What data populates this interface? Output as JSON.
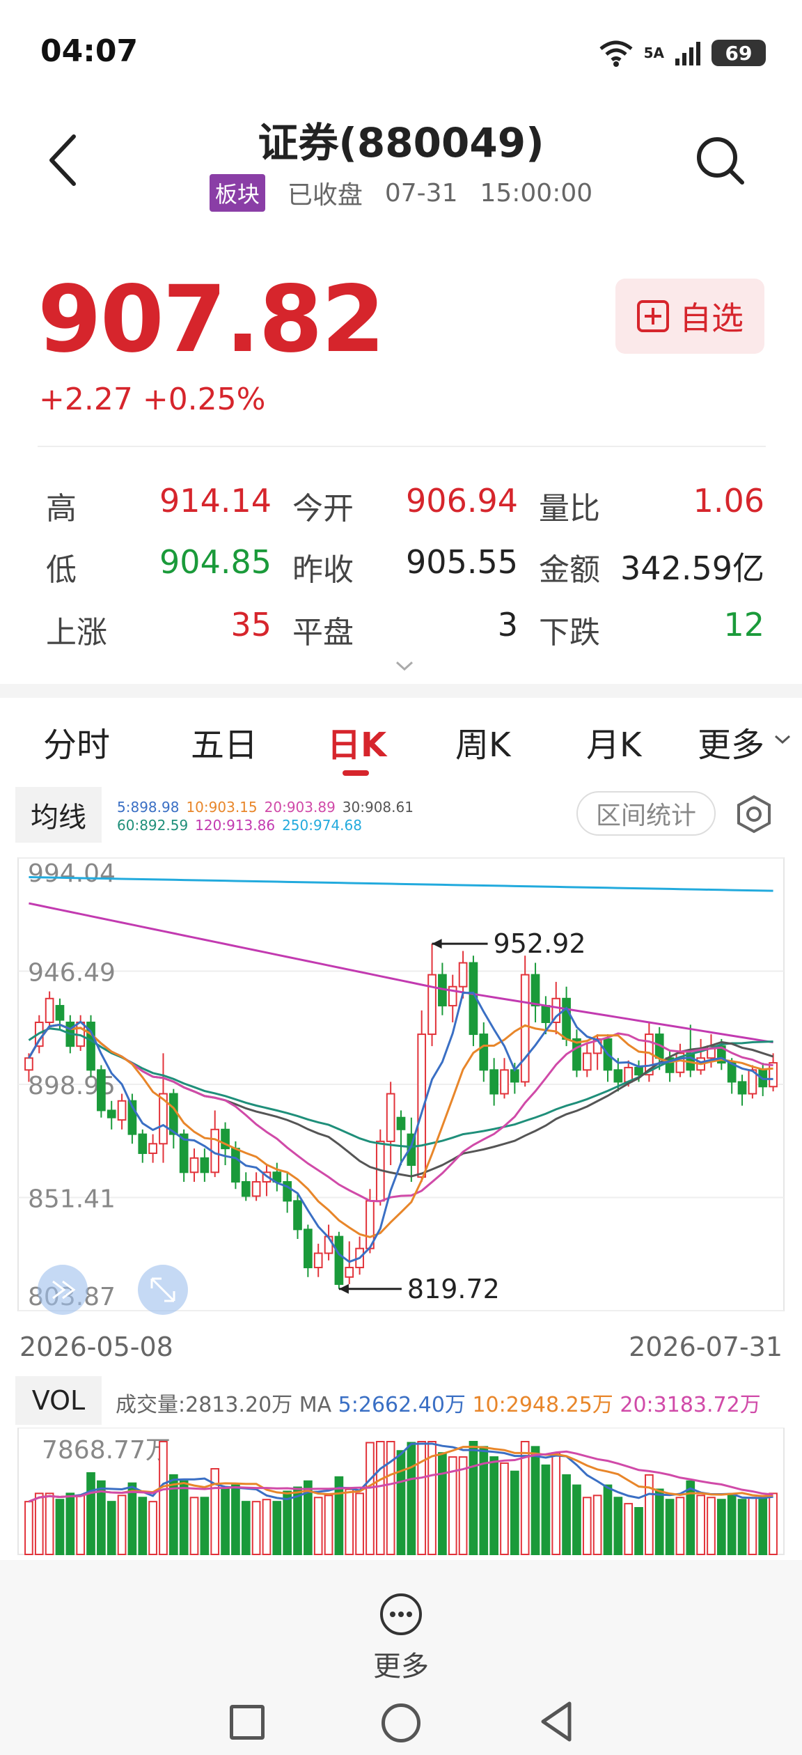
{
  "status": {
    "time": "04:07",
    "network": "5A",
    "battery": "69"
  },
  "header": {
    "title": "证券(880049)",
    "tag": "板块",
    "market_status": "已收盘",
    "date": "07-31",
    "time": "15:00:00"
  },
  "quote": {
    "price": "907.82",
    "change": "+2.27 +0.25%",
    "watch_label": "自选"
  },
  "stats": [
    {
      "label": "高",
      "value": "914.14",
      "color": "red"
    },
    {
      "label": "今开",
      "value": "906.94",
      "color": "red"
    },
    {
      "label": "量比",
      "value": "1.06",
      "color": "red"
    },
    {
      "label": "低",
      "value": "904.85",
      "color": "green"
    },
    {
      "label": "昨收",
      "value": "905.55",
      "color": "black"
    },
    {
      "label": "金额",
      "value": "342.59亿",
      "color": "black"
    },
    {
      "label": "上涨",
      "value": "35",
      "color": "red"
    },
    {
      "label": "平盘",
      "value": "3",
      "color": "black"
    },
    {
      "label": "下跌",
      "value": "12",
      "color": "green"
    }
  ],
  "tabs": [
    "分时",
    "五日",
    "日K",
    "周K",
    "月K",
    "更多"
  ],
  "active_tab": "日K",
  "ma": {
    "label": "均线",
    "line1": [
      "5:898.98",
      "10:903.15",
      "20:903.89",
      "30:908.61"
    ],
    "line2": [
      "60:892.59",
      "120:913.86",
      "250:974.68"
    ],
    "colors": [
      "#3a6fc4",
      "#e8862a",
      "#d04aa8",
      "#555555",
      "#1f8f7a",
      "#c23ab0",
      "#22aadd"
    ],
    "range_button": "区间统计"
  },
  "chart_data": {
    "type": "candlestick",
    "y_ticks": [
      "994.04",
      "946.49",
      "898.95",
      "851.41",
      "803.87"
    ],
    "ylim": [
      803.87,
      994.04
    ],
    "x_start": "2026-05-08",
    "x_end": "2026-07-31",
    "annotations": [
      {
        "label": "952.92",
        "kind": "high"
      },
      {
        "label": "819.72",
        "kind": "low"
      }
    ],
    "candles": [
      [
        905,
        910,
        900,
        912
      ],
      [
        915,
        925,
        912,
        928
      ],
      [
        925,
        935,
        922,
        938
      ],
      [
        932,
        926,
        922,
        935
      ],
      [
        925,
        915,
        912,
        928
      ],
      [
        915,
        925,
        913,
        928
      ],
      [
        925,
        905,
        902,
        928
      ],
      [
        905,
        888,
        885,
        907
      ],
      [
        888,
        885,
        880,
        892
      ],
      [
        884,
        892,
        880,
        895
      ],
      [
        892,
        878,
        874,
        895
      ],
      [
        878,
        870,
        866,
        880
      ],
      [
        870,
        874,
        866,
        878
      ],
      [
        874,
        895,
        866,
        912
      ],
      [
        895,
        878,
        872,
        897
      ],
      [
        878,
        862,
        858,
        880
      ],
      [
        862,
        868,
        858,
        872
      ],
      [
        868,
        862,
        858,
        872
      ],
      [
        862,
        880,
        860,
        888
      ],
      [
        880,
        872,
        865,
        883
      ],
      [
        872,
        858,
        855,
        875
      ],
      [
        858,
        852,
        850,
        862
      ],
      [
        852,
        858,
        850,
        862
      ],
      [
        858,
        862,
        852,
        865
      ],
      [
        862,
        858,
        854,
        866
      ],
      [
        858,
        850,
        845,
        862
      ],
      [
        850,
        838,
        834,
        853
      ],
      [
        838,
        822,
        818,
        840
      ],
      [
        822,
        828,
        818,
        832
      ],
      [
        828,
        835,
        825,
        840
      ],
      [
        835,
        815,
        813,
        837
      ],
      [
        818,
        822,
        815,
        833
      ],
      [
        822,
        830,
        819,
        835
      ],
      [
        830,
        850,
        828,
        855
      ],
      [
        850,
        875,
        848,
        880
      ],
      [
        875,
        895,
        865,
        900
      ],
      [
        885,
        880,
        865,
        888
      ],
      [
        878,
        865,
        858,
        885
      ],
      [
        860,
        920,
        858,
        930
      ],
      [
        920,
        945,
        915,
        958
      ],
      [
        945,
        932,
        928,
        950
      ],
      [
        932,
        940,
        925,
        945
      ],
      [
        940,
        950,
        935,
        955
      ],
      [
        950,
        920,
        915,
        953
      ],
      [
        920,
        905,
        900,
        925
      ],
      [
        905,
        895,
        890,
        910
      ],
      [
        895,
        905,
        893,
        910
      ],
      [
        905,
        900,
        895,
        908
      ],
      [
        900,
        945,
        898,
        953
      ],
      [
        945,
        932,
        925,
        950
      ],
      [
        932,
        925,
        920,
        936
      ],
      [
        925,
        935,
        920,
        942
      ],
      [
        935,
        918,
        915,
        940
      ],
      [
        918,
        905,
        902,
        922
      ],
      [
        905,
        912,
        902,
        916
      ],
      [
        912,
        918,
        905,
        920
      ],
      [
        918,
        905,
        900,
        920
      ],
      [
        905,
        900,
        896,
        910
      ],
      [
        900,
        906,
        898,
        909
      ],
      [
        906,
        903,
        900,
        909
      ],
      [
        903,
        920,
        900,
        925
      ],
      [
        920,
        910,
        905,
        923
      ],
      [
        910,
        904,
        900,
        913
      ],
      [
        904,
        912,
        902,
        916
      ],
      [
        912,
        905,
        902,
        924
      ],
      [
        905,
        910,
        903,
        918
      ],
      [
        910,
        915,
        906,
        920
      ],
      [
        915,
        908,
        905,
        918
      ],
      [
        908,
        900,
        895,
        910
      ],
      [
        900,
        895,
        890,
        903
      ],
      [
        895,
        905,
        893,
        907
      ],
      [
        905,
        898,
        894,
        908
      ],
      [
        898,
        908,
        896,
        912
      ]
    ]
  },
  "volume": {
    "label": "VOL",
    "legend_prefix": "成交量:2813.20万 MA",
    "ma5": "5:2662.40万",
    "ma10": "10:2948.25万",
    "ma20": "20:3183.72万",
    "max_label": "7868.77万"
  },
  "bottom": {
    "more_label": "更多"
  }
}
